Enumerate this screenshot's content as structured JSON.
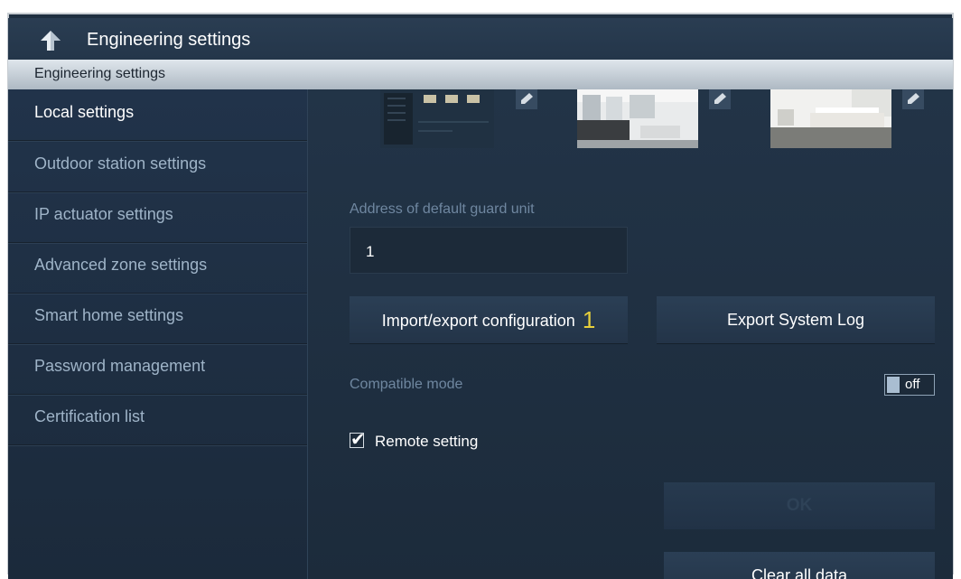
{
  "titlebar": {
    "title": "Engineering settings"
  },
  "section_header": "Engineering settings",
  "sidebar": {
    "items": [
      {
        "label": "Local settings",
        "active": true
      },
      {
        "label": "Outdoor station settings",
        "active": false
      },
      {
        "label": "IP actuator settings",
        "active": false
      },
      {
        "label": "Advanced zone settings",
        "active": false
      },
      {
        "label": "Smart home settings",
        "active": false
      },
      {
        "label": "Password management",
        "active": false
      },
      {
        "label": "Certification list",
        "active": false
      }
    ]
  },
  "main": {
    "wallpapers": [
      {
        "name": "screen-preview-wallpaper"
      },
      {
        "name": "living-room-wallpaper"
      },
      {
        "name": "bedroom-wallpaper"
      }
    ],
    "guard_unit": {
      "label": "Address of default guard unit",
      "value": "1"
    },
    "import_export_button": {
      "label": "Import/export configuration",
      "badge": "1"
    },
    "export_log_button": "Export System Log",
    "compatible_mode": {
      "label": "Compatible mode",
      "state": "off"
    },
    "remote_setting": {
      "label": "Remote setting",
      "checked": true
    },
    "ok_button": "OK",
    "clear_button": "Clear all data"
  },
  "colors": {
    "background": "#1f2f40",
    "label_muted": "#6f87a0",
    "badge": "#e6cf3c",
    "header_bar": "#c9d2da"
  }
}
